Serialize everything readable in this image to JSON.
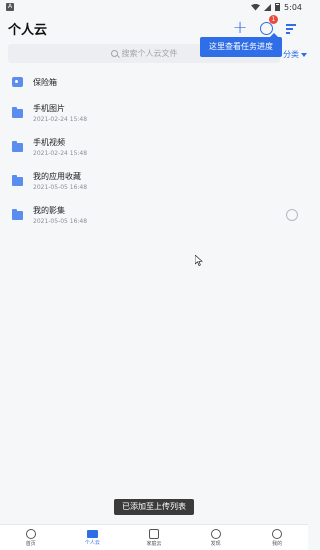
{
  "status": {
    "time": "5:04",
    "app_badge": "A"
  },
  "header": {
    "title": "个人云",
    "badge_count": "1"
  },
  "tooltip": "这里查看任务进度",
  "search": {
    "placeholder": "搜索个人云文件",
    "category_label": "分类"
  },
  "items": [
    {
      "name": "保险箱",
      "date": "",
      "icon": "lock-folder-icon"
    },
    {
      "name": "手机图片",
      "date": "2021-02-24 15:48",
      "icon": "folder-icon"
    },
    {
      "name": "手机视频",
      "date": "2021-02-24 15:48",
      "icon": "folder-icon"
    },
    {
      "name": "我的应用收藏",
      "date": "2021-05-05 16:48",
      "icon": "folder-icon"
    },
    {
      "name": "我的影集",
      "date": "2021-05-05 16:48",
      "icon": "folder-icon"
    }
  ],
  "toast": "已添加至上传列表",
  "nav": [
    "首页",
    "个人云",
    "家庭云",
    "发现",
    "我的"
  ],
  "colors": {
    "accent": "#2f6ee6",
    "badge": "#e84b3c",
    "folder": "#5b8def"
  }
}
